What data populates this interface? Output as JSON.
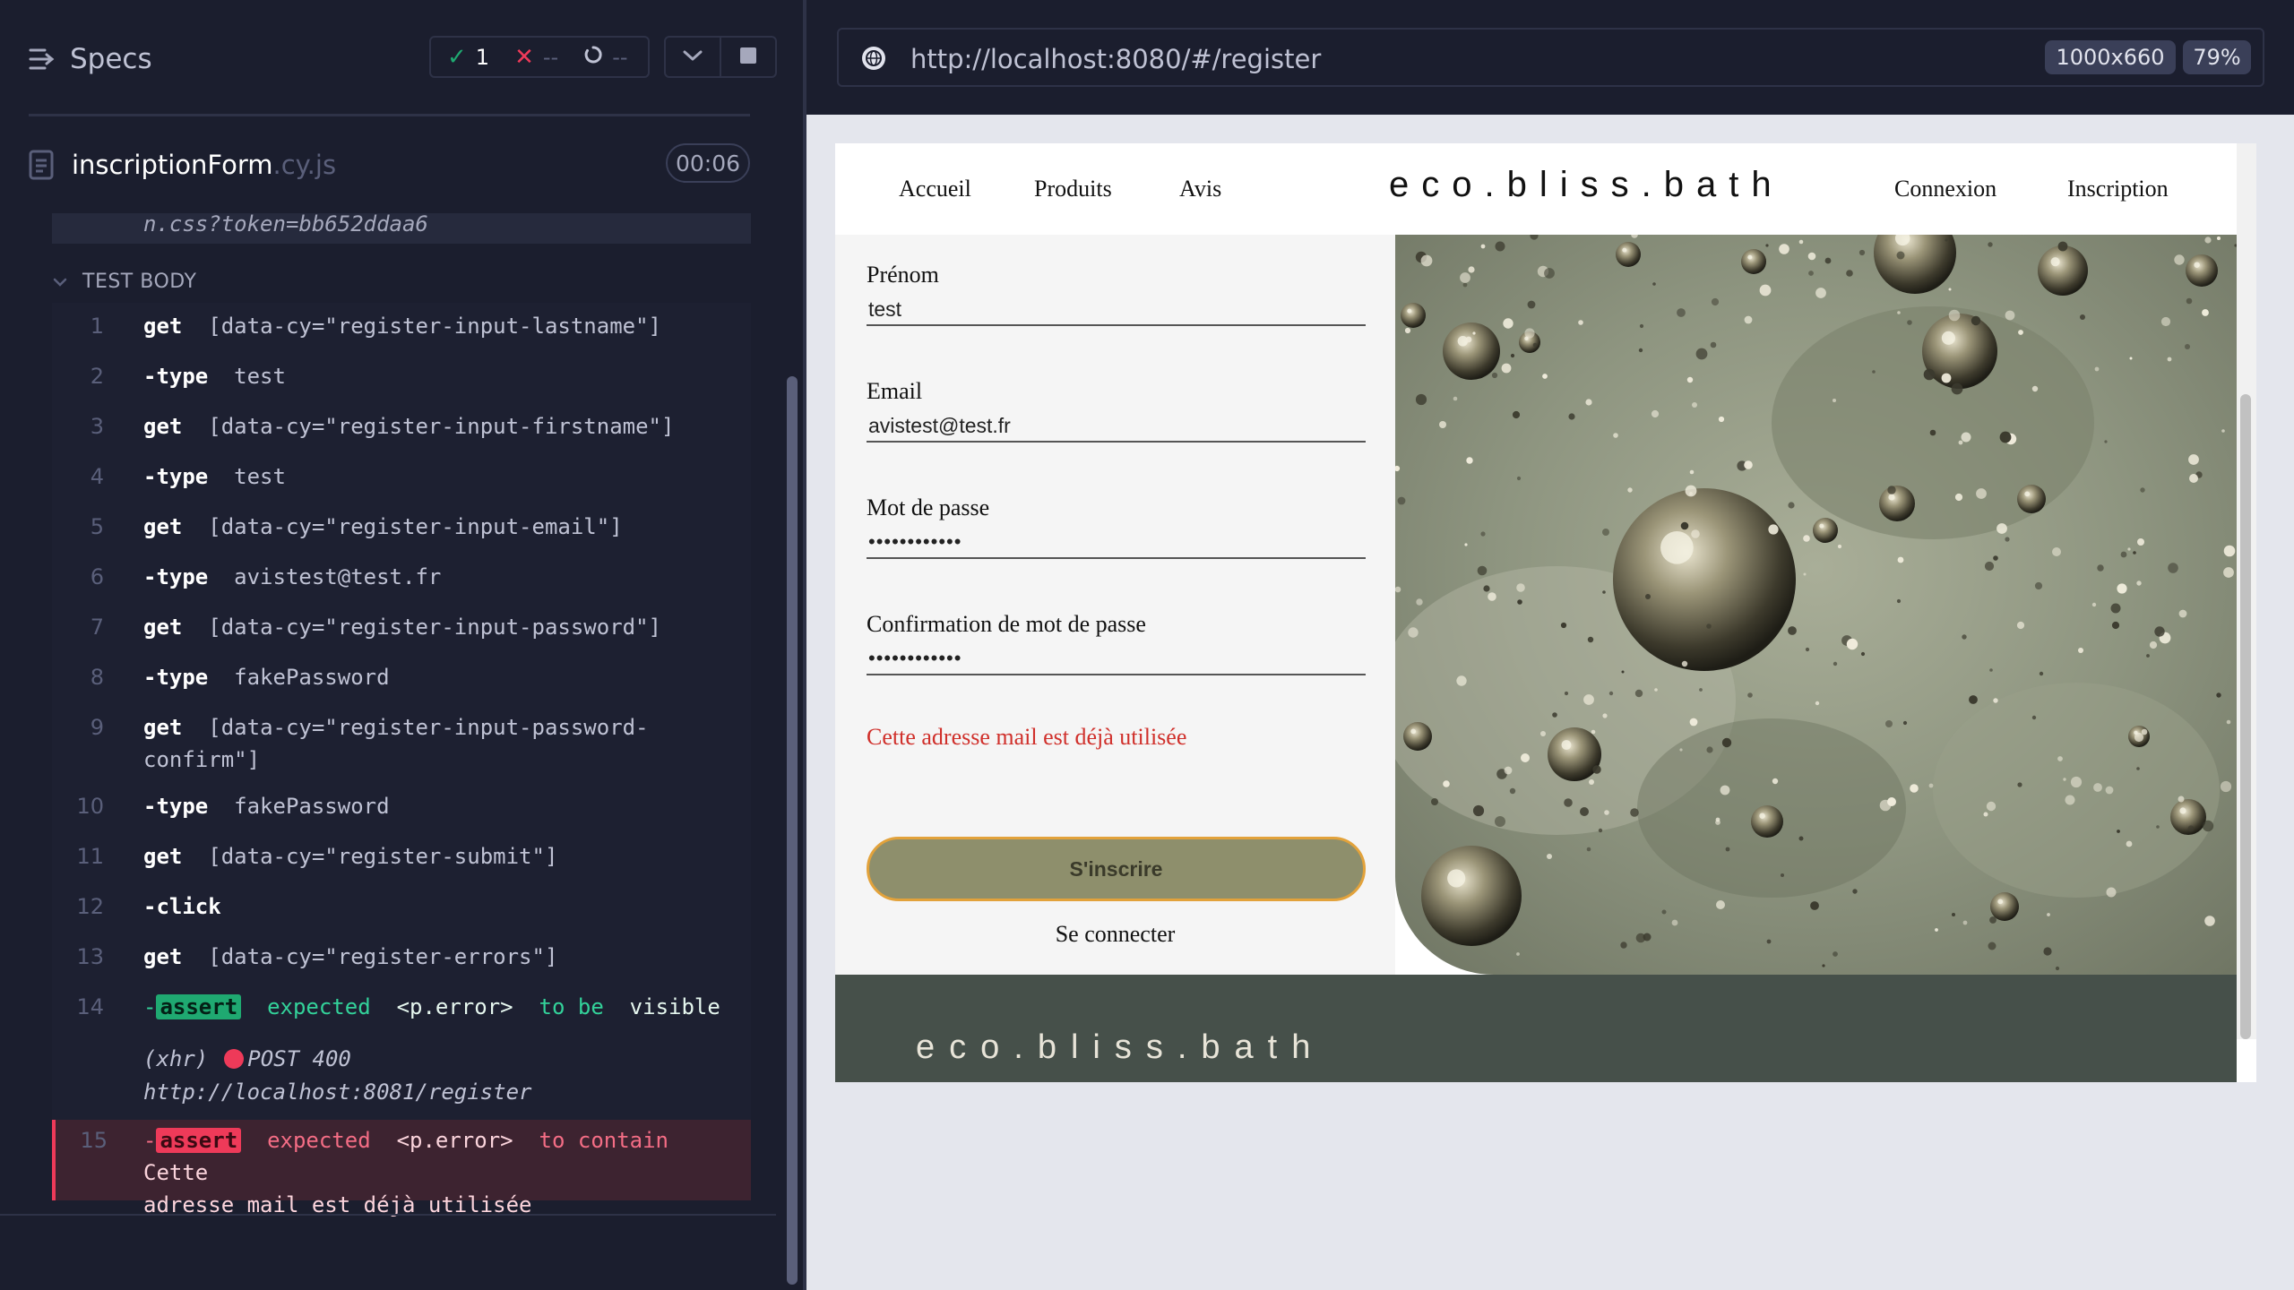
{
  "reporter": {
    "specs_label": "Specs",
    "stats": {
      "passed": "1",
      "failed": "--",
      "pending": "--"
    },
    "spec": {
      "name": "inscriptionForm",
      "ext": ".cy.js",
      "timer": "00:06"
    },
    "previous_command": "n.css?token=bb652ddaa6",
    "section_title": "TEST BODY",
    "commands": [
      {
        "num": "1",
        "method": "get",
        "message": "[data-cy=\"register-input-lastname\"]"
      },
      {
        "num": "2",
        "method": "-type",
        "message": "test"
      },
      {
        "num": "3",
        "method": "get",
        "message": "[data-cy=\"register-input-firstname\"]"
      },
      {
        "num": "4",
        "method": "-type",
        "message": "test"
      },
      {
        "num": "5",
        "method": "get",
        "message": "[data-cy=\"register-input-email\"]"
      },
      {
        "num": "6",
        "method": "-type",
        "message": "avistest@test.fr"
      },
      {
        "num": "7",
        "method": "get",
        "message": "[data-cy=\"register-input-password\"]"
      },
      {
        "num": "8",
        "method": "-type",
        "message": "fakePassword"
      },
      {
        "num": "9",
        "method": "get",
        "message": "[data-cy=\"register-input-password-",
        "message2": "confirm\"]"
      },
      {
        "num": "10",
        "method": "-type",
        "message": "fakePassword"
      },
      {
        "num": "11",
        "method": "get",
        "message": "[data-cy=\"register-submit\"]"
      },
      {
        "num": "12",
        "method": "-click",
        "message": ""
      },
      {
        "num": "13",
        "method": "get",
        "message": "[data-cy=\"register-errors\"]"
      }
    ],
    "assert_pass": {
      "num": "14",
      "dash": "-",
      "badge": "assert",
      "expected": "expected",
      "subject": "<p.error>",
      "to_be": "to be",
      "visible": "visible"
    },
    "xhr": {
      "type": "(xhr)",
      "status": "POST 400",
      "url": "http://localhost:8081/register"
    },
    "assert_fail": {
      "num": "15",
      "dash": "-",
      "badge": "assert",
      "expected": "expected",
      "subject": "<p.error>",
      "to_contain": "to contain",
      "text1": "Cette",
      "text2": "adresse mail est déjà utilisée"
    }
  },
  "aut": {
    "url": "http://localhost:8080/#/register",
    "viewport": "1000x660",
    "zoom": "79%"
  },
  "app": {
    "nav": {
      "home": "Accueil",
      "products": "Produits",
      "reviews": "Avis",
      "login": "Connexion",
      "register": "Inscription"
    },
    "brand": "eco.bliss.bath",
    "form": {
      "firstname_label": "Prénom",
      "firstname_value": "test",
      "email_label": "Email",
      "email_value": "avistest@test.fr",
      "password_label": "Mot de passe",
      "password_value": "••••••••••••",
      "confirm_label": "Confirmation de mot de passe",
      "confirm_value": "••••••••••••",
      "error": "Cette adresse mail est déjà utilisée",
      "submit": "S'inscrire",
      "login_link": "Se connecter"
    },
    "footer_brand": "eco.bliss.bath"
  },
  "colors": {
    "pass": "#1fa971",
    "fail": "#ee3a59",
    "error_text": "#d0302b",
    "button": "#8e8f6c",
    "footer": "#46504a"
  }
}
